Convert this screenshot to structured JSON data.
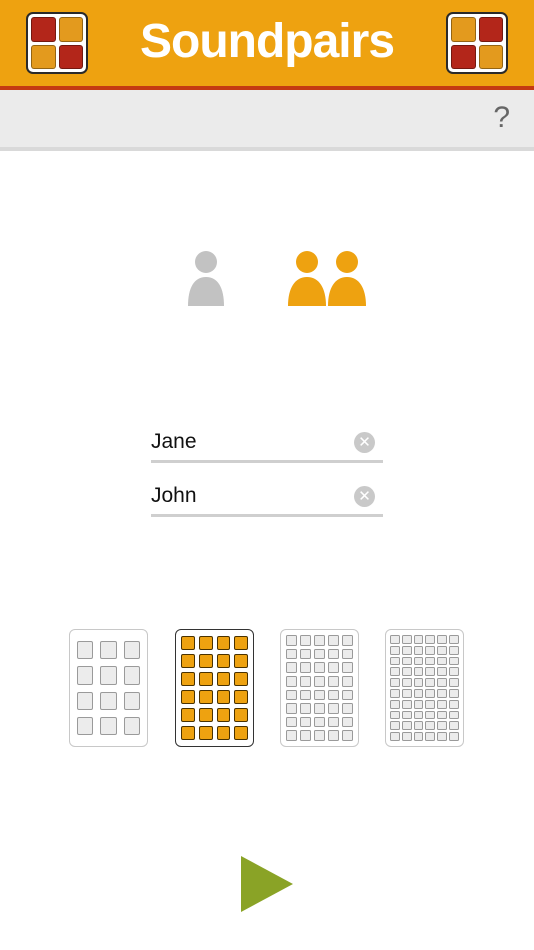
{
  "app": {
    "title": "Soundpairs"
  },
  "colors": {
    "header": "#eea210",
    "header_line": "#c43912",
    "tile_red": "#b3261a",
    "tile_orange": "#e39a1e",
    "selected_accent": "#eea210",
    "unselected_icon": "#c2c2c2",
    "play": "#8aa326"
  },
  "header": {
    "left_logo": {
      "icon": "tiles-logo-icon",
      "tiles": [
        "red",
        "orange",
        "orange",
        "red"
      ]
    },
    "right_logo": {
      "icon": "tiles-logo-icon",
      "tiles": [
        "orange",
        "red",
        "red",
        "orange"
      ]
    }
  },
  "toolbar": {
    "help_label": "?"
  },
  "players": {
    "options": [
      {
        "icon": "single-player-icon",
        "count": 1,
        "selected": false
      },
      {
        "icon": "two-players-icon",
        "count": 2,
        "selected": true
      }
    ]
  },
  "names": {
    "player1": {
      "value": "Jane",
      "clear_icon": "clear-icon"
    },
    "player2": {
      "value": "John",
      "clear_icon": "clear-icon"
    }
  },
  "grids": [
    {
      "cols": 3,
      "rows": 4,
      "selected": false
    },
    {
      "cols": 4,
      "rows": 6,
      "selected": true
    },
    {
      "cols": 5,
      "rows": 8,
      "selected": false
    },
    {
      "cols": 6,
      "rows": 10,
      "selected": false
    }
  ],
  "play": {
    "icon": "play-icon"
  }
}
